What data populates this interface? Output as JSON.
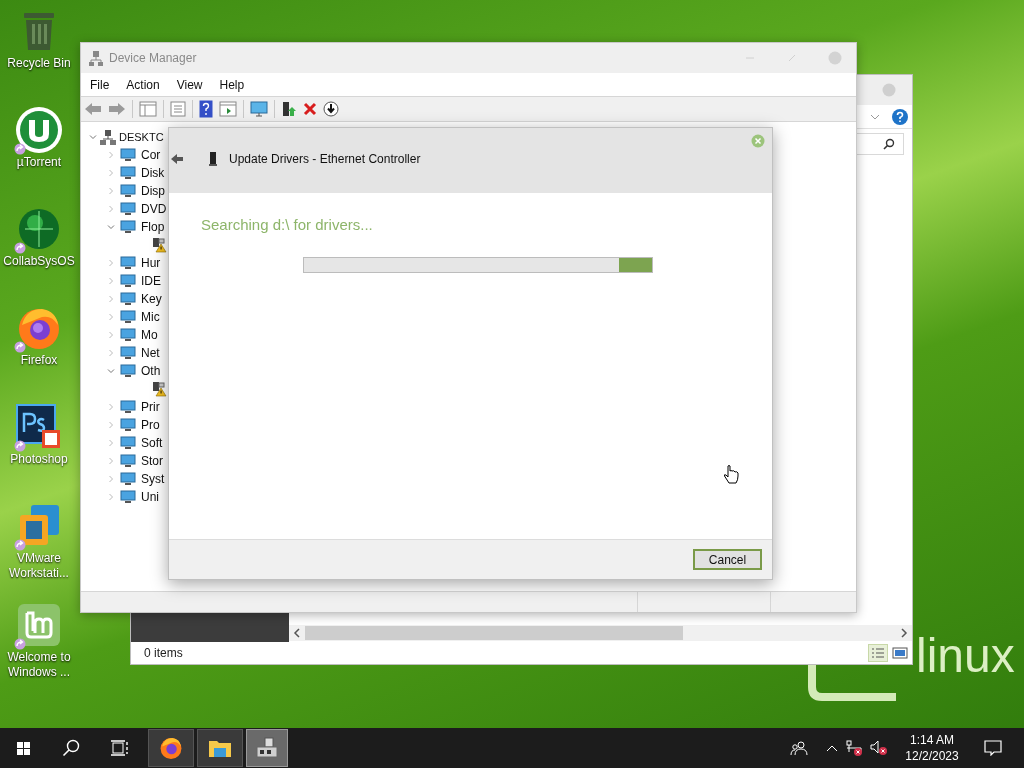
{
  "desktop_icons": [
    {
      "label": "Recycle Bin",
      "kind": "recycle",
      "shortcut": false
    },
    {
      "label": "µTorrent",
      "kind": "torrent",
      "shortcut": true
    },
    {
      "label": "CollabSysOS",
      "kind": "globe",
      "shortcut": true
    },
    {
      "label": "Firefox",
      "kind": "firefox",
      "shortcut": true
    },
    {
      "label": "Photoshop",
      "kind": "photoshop",
      "shortcut": true
    },
    {
      "label": "VMware Workstati...",
      "kind": "vmware",
      "shortcut": true
    },
    {
      "label": "Welcome to Windows ...",
      "kind": "mint",
      "shortcut": true
    }
  ],
  "wallpaper_logo": "linux",
  "explorer": {
    "status": "0 items"
  },
  "device_manager": {
    "title": "Device Manager",
    "menu": [
      "File",
      "Action",
      "View",
      "Help"
    ],
    "tree": {
      "label": "DESKTC",
      "expanded": true,
      "children": [
        {
          "label": "Cor",
          "expanded": false
        },
        {
          "label": "Disk",
          "expanded": false
        },
        {
          "label": "Disp",
          "expanded": false
        },
        {
          "label": "DVD",
          "expanded": false
        },
        {
          "label": "Flop",
          "expanded": true,
          "children": [
            {
              "kind": "warning-device"
            }
          ]
        },
        {
          "label": "Hur",
          "expanded": false
        },
        {
          "label": "IDE",
          "expanded": false
        },
        {
          "label": "Key",
          "expanded": false
        },
        {
          "label": "Mic",
          "expanded": false
        },
        {
          "label": "Mo",
          "expanded": false
        },
        {
          "label": "Net",
          "expanded": false
        },
        {
          "label": "Oth",
          "expanded": true,
          "children": [
            {
              "kind": "warning-device"
            }
          ]
        },
        {
          "label": "Prir",
          "expanded": false
        },
        {
          "label": "Pro",
          "expanded": false
        },
        {
          "label": "Soft",
          "expanded": false
        },
        {
          "label": "Stor",
          "expanded": false
        },
        {
          "label": "Syst",
          "expanded": false
        },
        {
          "label": "Uni",
          "expanded": false
        }
      ]
    }
  },
  "dialog": {
    "title": "Update Drivers - Ethernet Controller",
    "status": "Searching d:\\ for drivers...",
    "button": "Cancel"
  },
  "taskbar": {
    "apps": [
      {
        "kind": "firefox",
        "selected": false
      },
      {
        "kind": "explorer",
        "selected": false
      },
      {
        "kind": "device-manager",
        "selected": true
      }
    ],
    "time": "1:14 AM",
    "date": "12/2/2023"
  }
}
